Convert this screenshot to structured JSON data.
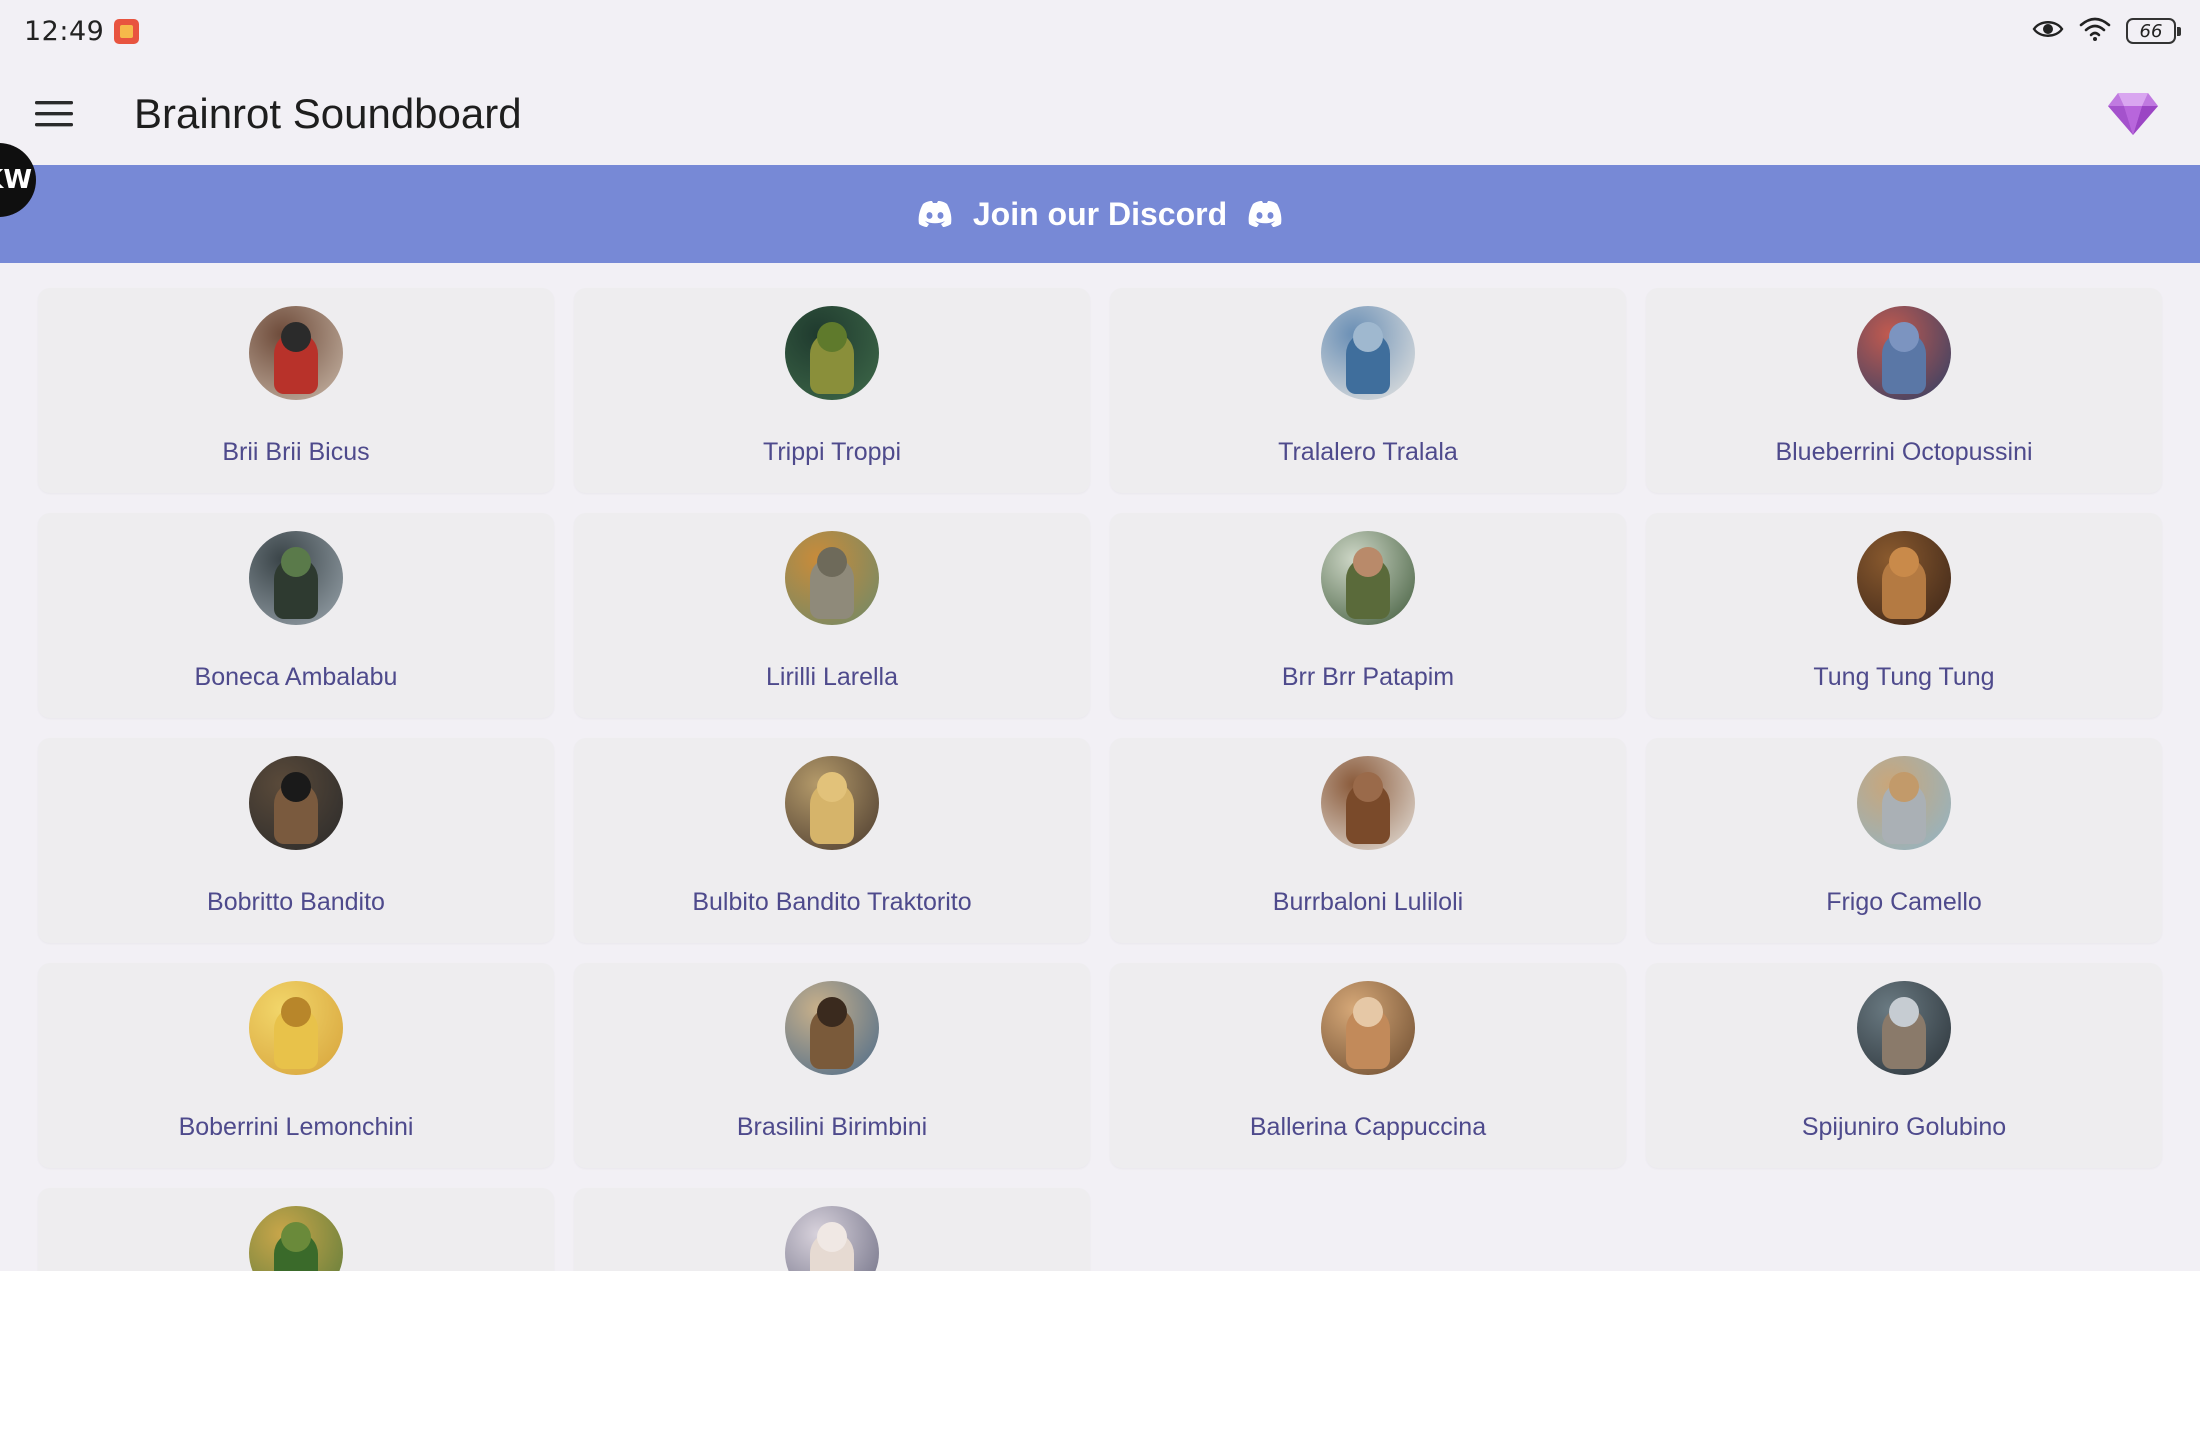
{
  "status_bar": {
    "time": "12:49",
    "battery": "66"
  },
  "app_bar": {
    "title": "Brainrot Soundboard"
  },
  "avatar": {
    "initials": "KW"
  },
  "banner": {
    "text": "Join our Discord"
  },
  "colors": {
    "accent": "#7789d6",
    "label": "#4e4a8c",
    "gem": "#b069d8"
  },
  "sounds": [
    {
      "name": "Brii Brii Bicus",
      "bg": [
        "#c9b8a8",
        "#6e4b3a"
      ],
      "fig": "#b8322a",
      "head": "#2b2b2b"
    },
    {
      "name": "Trippi Troppi",
      "bg": [
        "#3f6a4a",
        "#1f3a2e"
      ],
      "fig": "#8a8f3a",
      "head": "#5f7a2c"
    },
    {
      "name": "Tralalero Tralala",
      "bg": [
        "#e8e6e2",
        "#6a8fb5"
      ],
      "fig": "#3f6e9c",
      "head": "#9fb8cf"
    },
    {
      "name": "Blueberrini Octopussini",
      "bg": [
        "#2d3f66",
        "#c25a4f"
      ],
      "fig": "#5a77a6",
      "head": "#7c94c0"
    },
    {
      "name": "Boneca Ambalabu",
      "bg": [
        "#9aa5ad",
        "#3a4448"
      ],
      "fig": "#2e3a30",
      "head": "#5a7a4a"
    },
    {
      "name": "Lirilli Larella",
      "bg": [
        "#6c8a6a",
        "#c98b3a"
      ],
      "fig": "#8f8a7a",
      "head": "#6e6a5a"
    },
    {
      "name": "Brr Brr Patapim",
      "bg": [
        "#3f5a3a",
        "#cdd6c6"
      ],
      "fig": "#5a6a3a",
      "head": "#b98a6a"
    },
    {
      "name": "Tung Tung Tung",
      "bg": [
        "#3a2418",
        "#8a5a2e"
      ],
      "fig": "#b47a42",
      "head": "#c98a4a"
    },
    {
      "name": "Bobritto Bandito",
      "bg": [
        "#2a2a2a",
        "#5a4a3a"
      ],
      "fig": "#7a5a3e",
      "head": "#1a1a1a"
    },
    {
      "name": "Bulbito Bandito Traktorito",
      "bg": [
        "#4a3a2e",
        "#b49a6a"
      ],
      "fig": "#d6b46a",
      "head": "#e2c27a"
    },
    {
      "name": "Burrbaloni Luliloli",
      "bg": [
        "#e6e2dc",
        "#8a5a3a"
      ],
      "fig": "#7a4a2a",
      "head": "#9a6a4a"
    },
    {
      "name": "Frigo Camello",
      "bg": [
        "#8fb5c9",
        "#c9a67a"
      ],
      "fig": "#aab0b5",
      "head": "#c29a6a"
    },
    {
      "name": "Boberrini Lemonchini",
      "bg": [
        "#d6a23a",
        "#f2d66a"
      ],
      "fig": "#e8c24a",
      "head": "#b8862a"
    },
    {
      "name": "Brasilini Birimbini",
      "bg": [
        "#4a6a8a",
        "#c8b08a"
      ],
      "fig": "#7a5a3a",
      "head": "#3a2a1e"
    },
    {
      "name": "Ballerina Cappuccina",
      "bg": [
        "#6a4a2e",
        "#d6a878"
      ],
      "fig": "#c28a5a",
      "head": "#e6c8a6"
    },
    {
      "name": "Spijuniro Golubino",
      "bg": [
        "#2a3238",
        "#6a7a82"
      ],
      "fig": "#8a7a6a",
      "head": "#c6ccd2"
    },
    {
      "name": "",
      "bg": [
        "#5a7a3a",
        "#c9a64a"
      ],
      "fig": "#3a6a2a",
      "head": "#6a8a3a"
    },
    {
      "name": "",
      "bg": [
        "#6a6a80",
        "#d8d2dc"
      ],
      "fig": "#e6dad2",
      "head": "#f0e8e4"
    }
  ]
}
